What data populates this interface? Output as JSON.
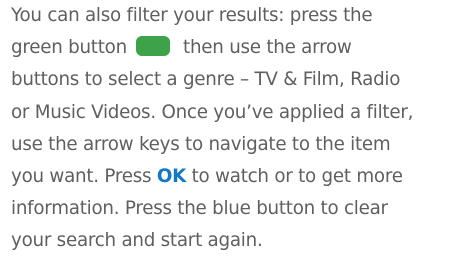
{
  "colors": {
    "text": "#5f5f5f",
    "green_button": "#3da24a",
    "ok_blue": "#1478c3"
  },
  "icons": {
    "green_button": "green-remote-button"
  },
  "paragraph": {
    "line1": "You can also filter your results: press the",
    "line2_a": "green button",
    "line2_b": "then use the arrow",
    "line3": "buttons to select a genre – TV & Film, Radio",
    "line4": "or Music Videos. Once you’ve applied a filter,",
    "line5": "use the arrow keys to navigate to the item",
    "line6_a": "you want. Press",
    "line6_ok": "OK",
    "line6_b": "to watch or to get more",
    "line7": "information. Press the blue button to clear",
    "line8": "your search and start again."
  }
}
